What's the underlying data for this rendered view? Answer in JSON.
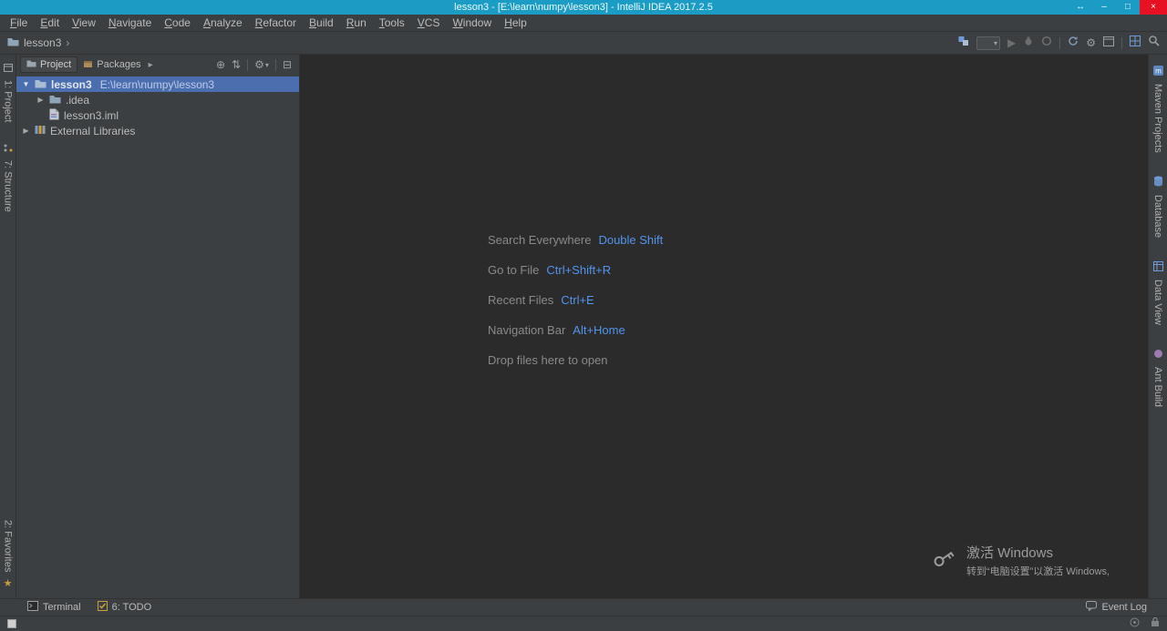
{
  "titlebar": {
    "title": "lesson3 - [E:\\learn\\numpy\\lesson3] - IntelliJ IDEA 2017.2.5",
    "controls": {
      "extra": "↔",
      "minimize": "–",
      "maximize": "□",
      "close": "×"
    }
  },
  "menubar": {
    "items": [
      "File",
      "Edit",
      "View",
      "Navigate",
      "Code",
      "Analyze",
      "Refactor",
      "Build",
      "Run",
      "Tools",
      "VCS",
      "Window",
      "Help"
    ]
  },
  "toolbar": {
    "breadcrumb": "lesson3",
    "chevron": "›"
  },
  "glyphs": {
    "tabs_more": "▸",
    "locate": "⊕",
    "collapse_all": "⇅",
    "gear": "⚙",
    "dropdown_arrow": "▾",
    "hide": "⊟",
    "expand": "▶",
    "collapse": "▼",
    "run": "▶",
    "star": "★"
  },
  "project": {
    "tabs": [
      {
        "label": "Project"
      },
      {
        "label": "Packages"
      }
    ],
    "rows": [
      {
        "label": "lesson3",
        "detail": "E:\\learn\\numpy\\lesson3"
      },
      {
        "label": ".idea"
      },
      {
        "label": "lesson3.iml"
      },
      {
        "label": "External Libraries"
      }
    ]
  },
  "editor": {
    "shortcuts": [
      {
        "action": "Search Everywhere",
        "keys": "Double Shift"
      },
      {
        "action": "Go to File",
        "keys": "Ctrl+Shift+R"
      },
      {
        "action": "Recent Files",
        "keys": "Ctrl+E"
      },
      {
        "action": "Navigation Bar",
        "keys": "Alt+Home"
      }
    ],
    "drop_hint": "Drop files here to open"
  },
  "tool_windows": {
    "left_top": [
      "1: Project",
      "7: Structure"
    ],
    "left_bottom": [
      "2: Favorites"
    ],
    "right": [
      "Maven Projects",
      "Database",
      "Data View",
      "Ant Build"
    ],
    "bottom": [
      "Terminal",
      "6: TODO"
    ],
    "event_log": "Event Log"
  },
  "watermark": {
    "line1": "激活 Windows",
    "line2": "转到“电脑设置”以激活 Windows,"
  },
  "colors": {
    "titlebar": "#1a9cc4",
    "selection": "#4b6eaf",
    "shortcut_link": "#5394ec",
    "editor_bg": "#2b2b2b",
    "panel_bg": "#3c3f41",
    "close_button": "#e81123"
  }
}
